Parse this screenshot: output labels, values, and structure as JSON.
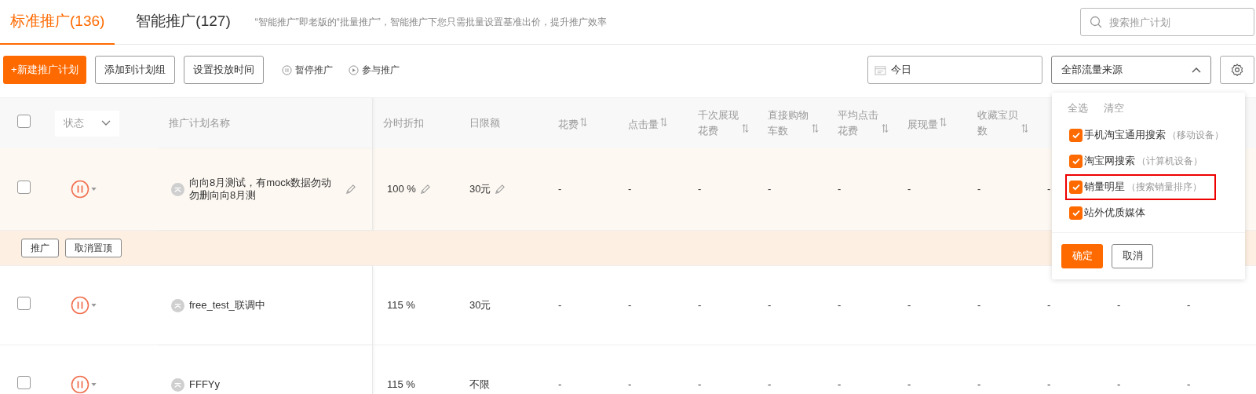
{
  "tabs": [
    {
      "label": "标准推广(136)",
      "selected": true
    },
    {
      "label": "智能推广(127)",
      "selected": false
    }
  ],
  "notice": "“智能推广”即老版的“批量推广”，智能推广下您只需批量设置基准出价，提升推广效率",
  "search": {
    "placeholder": "搜索推广计划"
  },
  "toolbar": [
    {
      "kind": "primary",
      "label": "+新建推广计划"
    },
    {
      "kind": "outline",
      "label": "添加到计划组"
    },
    {
      "kind": "outline",
      "label": "设置投放时间"
    },
    {
      "kind": "pause",
      "label": "暂停推广"
    },
    {
      "kind": "play",
      "label": "参与推广"
    }
  ],
  "date_field": {
    "value": "今日"
  },
  "source_select": {
    "value": "全部流量来源",
    "expanded": true
  },
  "table": {
    "select_all_checked": false,
    "status_filter": "状态",
    "name_column": "推广计划名称",
    "discount_column": "分时折扣",
    "limit_column": "日限额",
    "metric_columns": [
      {
        "label": "花费",
        "sortable": true
      },
      {
        "label": "点击量",
        "sortable": true
      },
      {
        "label": "千次展现花费",
        "sortable": true
      },
      {
        "label": "直接购物车数",
        "sortable": true
      },
      {
        "label": "平均点击花费",
        "sortable": true
      },
      {
        "label": "展现量",
        "sortable": true
      },
      {
        "label": "收藏宝贝数",
        "sortable": true
      }
    ],
    "rows": [
      {
        "checked": false,
        "pinned": true,
        "name": "向向8月测试，有mock数据勿动勿删向向8月测",
        "editable": true,
        "discount": "100 %",
        "daily_limit": "30元",
        "metrics": [
          "-",
          "-",
          "-",
          "-",
          "-",
          "-",
          "-",
          "-"
        ],
        "actions": [
          "推广",
          "取消置顶"
        ]
      },
      {
        "checked": false,
        "pinned": false,
        "name": "free_test_联调中",
        "editable": false,
        "discount": "115 %",
        "daily_limit": "30元",
        "metrics": [
          "-",
          "-",
          "-",
          "-",
          "-",
          "-",
          "-",
          "-",
          "-",
          "-"
        ]
      },
      {
        "checked": false,
        "pinned": false,
        "name": "FFFYy",
        "editable": false,
        "discount": "115 %",
        "daily_limit": "不限",
        "metrics": [
          "-",
          "-",
          "-",
          "-",
          "-",
          "-",
          "-",
          "-",
          "-",
          "-"
        ]
      }
    ]
  },
  "source_popup": {
    "links": [
      "全选",
      "清空"
    ],
    "options": [
      {
        "label": "手机淘宝通用搜索",
        "hint": "（移动设备）",
        "checked": true,
        "highlighted": false
      },
      {
        "label": "淘宝网搜索",
        "hint": "（计算机设备）",
        "checked": true,
        "highlighted": false
      },
      {
        "label": "销量明星",
        "hint": "（搜索销量排序）",
        "checked": true,
        "highlighted": true
      },
      {
        "label": "站外优质媒体",
        "checked": true,
        "highlighted": false
      }
    ],
    "confirm": "确定",
    "cancel": "取消"
  }
}
